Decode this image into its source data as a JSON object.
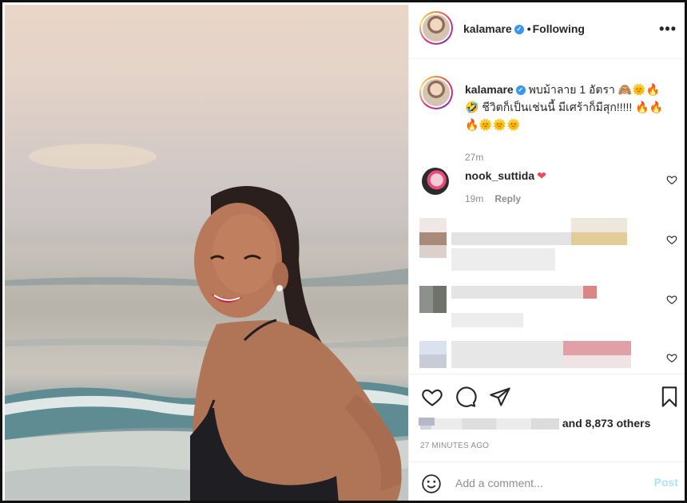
{
  "post": {
    "image_alt": "Woman smiling over her shoulder on a beach at sunset"
  },
  "header": {
    "username": "kalamare",
    "verified": true,
    "separator": "•",
    "follow_status": "Following",
    "more_label": "•••"
  },
  "caption": {
    "username": "kalamare",
    "text": "พบม้าลาย 1 อัตรา 🙈🌞🔥 🤣 ชีวิตก็เป็นเช่นนี้ มีเศร้าก็มีสุก!!!!! 🔥🔥 🔥🌞🌞🌞",
    "time": "27m"
  },
  "comments": [
    {
      "username": "nook_suttida",
      "text": "❤",
      "time": "19m",
      "reply_label": "Reply"
    }
  ],
  "actions": {
    "icons": [
      "heart-icon",
      "comment-icon",
      "share-icon",
      "bookmark-icon"
    ]
  },
  "likes": {
    "suffix": "and 8,873 others"
  },
  "timestamp": "27 MINUTES AGO",
  "add_comment": {
    "placeholder": "Add a comment...",
    "post_label": "Post"
  },
  "colors": {
    "accent": "#3897f0",
    "like_red": "#ed4956",
    "post_disabled": "#b2dffc",
    "muted_text": "#8e8e8e"
  }
}
